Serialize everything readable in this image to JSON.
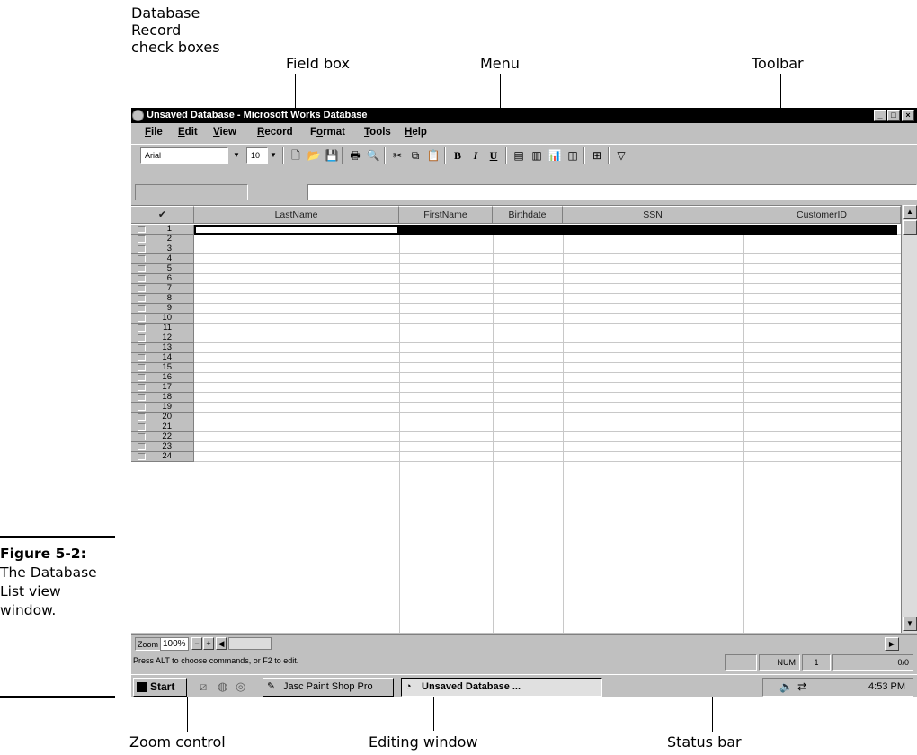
{
  "callouts": {
    "checkboxes": "Database\nRecord\ncheck boxes",
    "field_box": "Field box",
    "menu": "Menu",
    "toolbar": "Toolbar",
    "zoom_control": "Zoom control",
    "editing_window": "Editing window",
    "status_bar": "Status bar"
  },
  "figure": {
    "number": "Figure 5-2:",
    "caption": "The Database List view window."
  },
  "window": {
    "title": "Unsaved Database - Microsoft Works Database",
    "controls": [
      "_",
      "□",
      "×"
    ]
  },
  "menu": [
    {
      "key": "F",
      "rest": "ile"
    },
    {
      "key": "E",
      "rest": "dit"
    },
    {
      "key": "V",
      "rest": "iew"
    },
    {
      "key": "R",
      "rest": "ecord"
    },
    {
      "key": "o",
      "label": "Format"
    },
    {
      "key": "T",
      "rest": "ools"
    },
    {
      "key": "H",
      "rest": "elp"
    }
  ],
  "toolbar": {
    "font_name": "Arial",
    "font_size": "10",
    "icons": [
      "new-icon",
      "open-icon",
      "save-icon",
      "print-icon",
      "print-preview-icon",
      "cut-icon",
      "copy-icon",
      "paste-icon",
      "bold-icon",
      "italic-icon",
      "underline-icon",
      "list-view-icon",
      "form-view-icon",
      "report-icon",
      "form-design-icon",
      "insert-field-icon",
      "filter-icon"
    ],
    "bold": "B",
    "italic": "I",
    "underline": "U"
  },
  "grid": {
    "select_all_mark": "✔",
    "columns": [
      "LastName",
      "FirstName",
      "Birthdate",
      "SSN",
      "CustomerID"
    ],
    "rows": [
      "1",
      "2",
      "3",
      "4",
      "5",
      "6",
      "7",
      "8",
      "9",
      "10",
      "11",
      "12",
      "13",
      "14",
      "15",
      "16",
      "17",
      "18",
      "19",
      "20",
      "21",
      "22",
      "23",
      "24"
    ]
  },
  "zoom": {
    "label": "Zoom",
    "value": "100%",
    "minus": "−",
    "plus": "+"
  },
  "status": {
    "message": "Press ALT to choose commands, or F2 to edit.",
    "num": "NUM",
    "record": "1",
    "count": "0/0"
  },
  "taskbar": {
    "start": "Start",
    "tasks": [
      "Jasc Paint Shop Pro",
      "Unsaved Database ..."
    ],
    "clock": "4:53 PM"
  }
}
